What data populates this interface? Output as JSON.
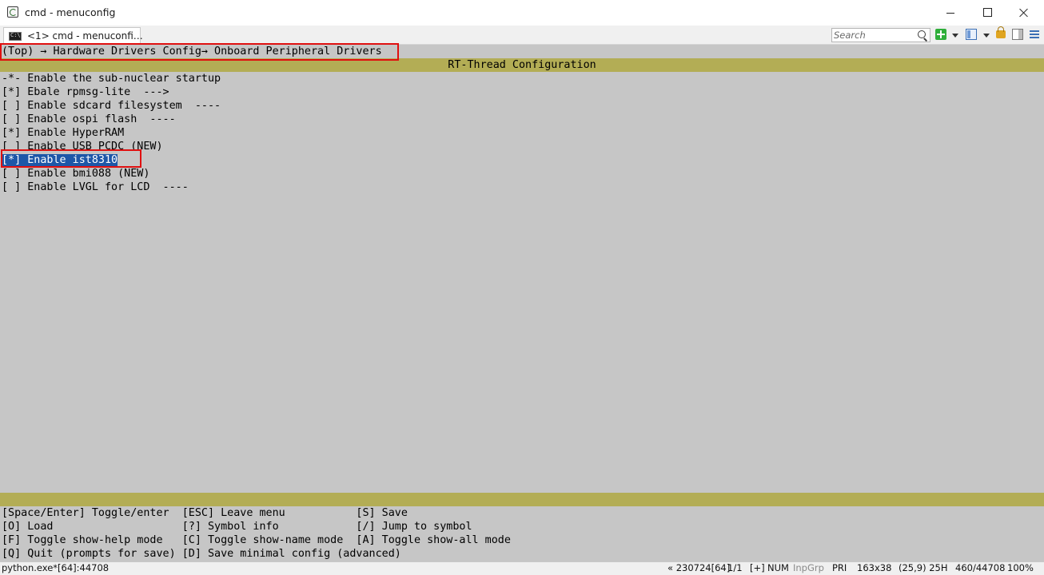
{
  "window": {
    "title": "cmd - menuconfig"
  },
  "tabs": [
    {
      "label": "<1> cmd - menuconfi…"
    }
  ],
  "toolbar": {
    "search_placeholder": "Search"
  },
  "menuconfig": {
    "breadcrumb": "(Top) → Hardware Drivers Config→ Onboard Peripheral Drivers",
    "header": "RT-Thread Configuration",
    "items": [
      {
        "text": "-*- Enable the sub-nuclear startup"
      },
      {
        "text": "[*] Ebale rpmsg-lite  --->"
      },
      {
        "text": "[ ] Enable sdcard filesystem  ----"
      },
      {
        "text": "[ ] Enable ospi flash  ----"
      },
      {
        "text": "[*] Enable HyperRAM"
      },
      {
        "text": "[ ] Enable USB PCDC (NEW)"
      },
      {
        "text": "[*] Enable ist8310",
        "selected": true
      },
      {
        "text": "[ ] Enable bmi088 (NEW)"
      },
      {
        "text": "[ ] Enable LVGL for LCD  ----"
      }
    ],
    "help_lines": [
      "[Space/Enter] Toggle/enter  [ESC] Leave menu           [S] Save",
      "[O] Load                    [?] Symbol info            [/] Jump to symbol",
      "[F] Toggle show-help mode   [C] Toggle show-name mode  [A] Toggle show-all mode",
      "[Q] Quit (prompts for save) [D] Save minimal config (advanced)"
    ]
  },
  "statusbar": {
    "process": "python.exe*[64]:44708",
    "pos_info": "« 230724[64]",
    "page": "1/1",
    "plus": "[+]",
    "num": "NUM",
    "inpgrp": "InpGrp",
    "pri": "PRI",
    "size": "163x38",
    "cursor": "(25,9) 25H",
    "progress": "460/44708",
    "zoom": "100%"
  }
}
